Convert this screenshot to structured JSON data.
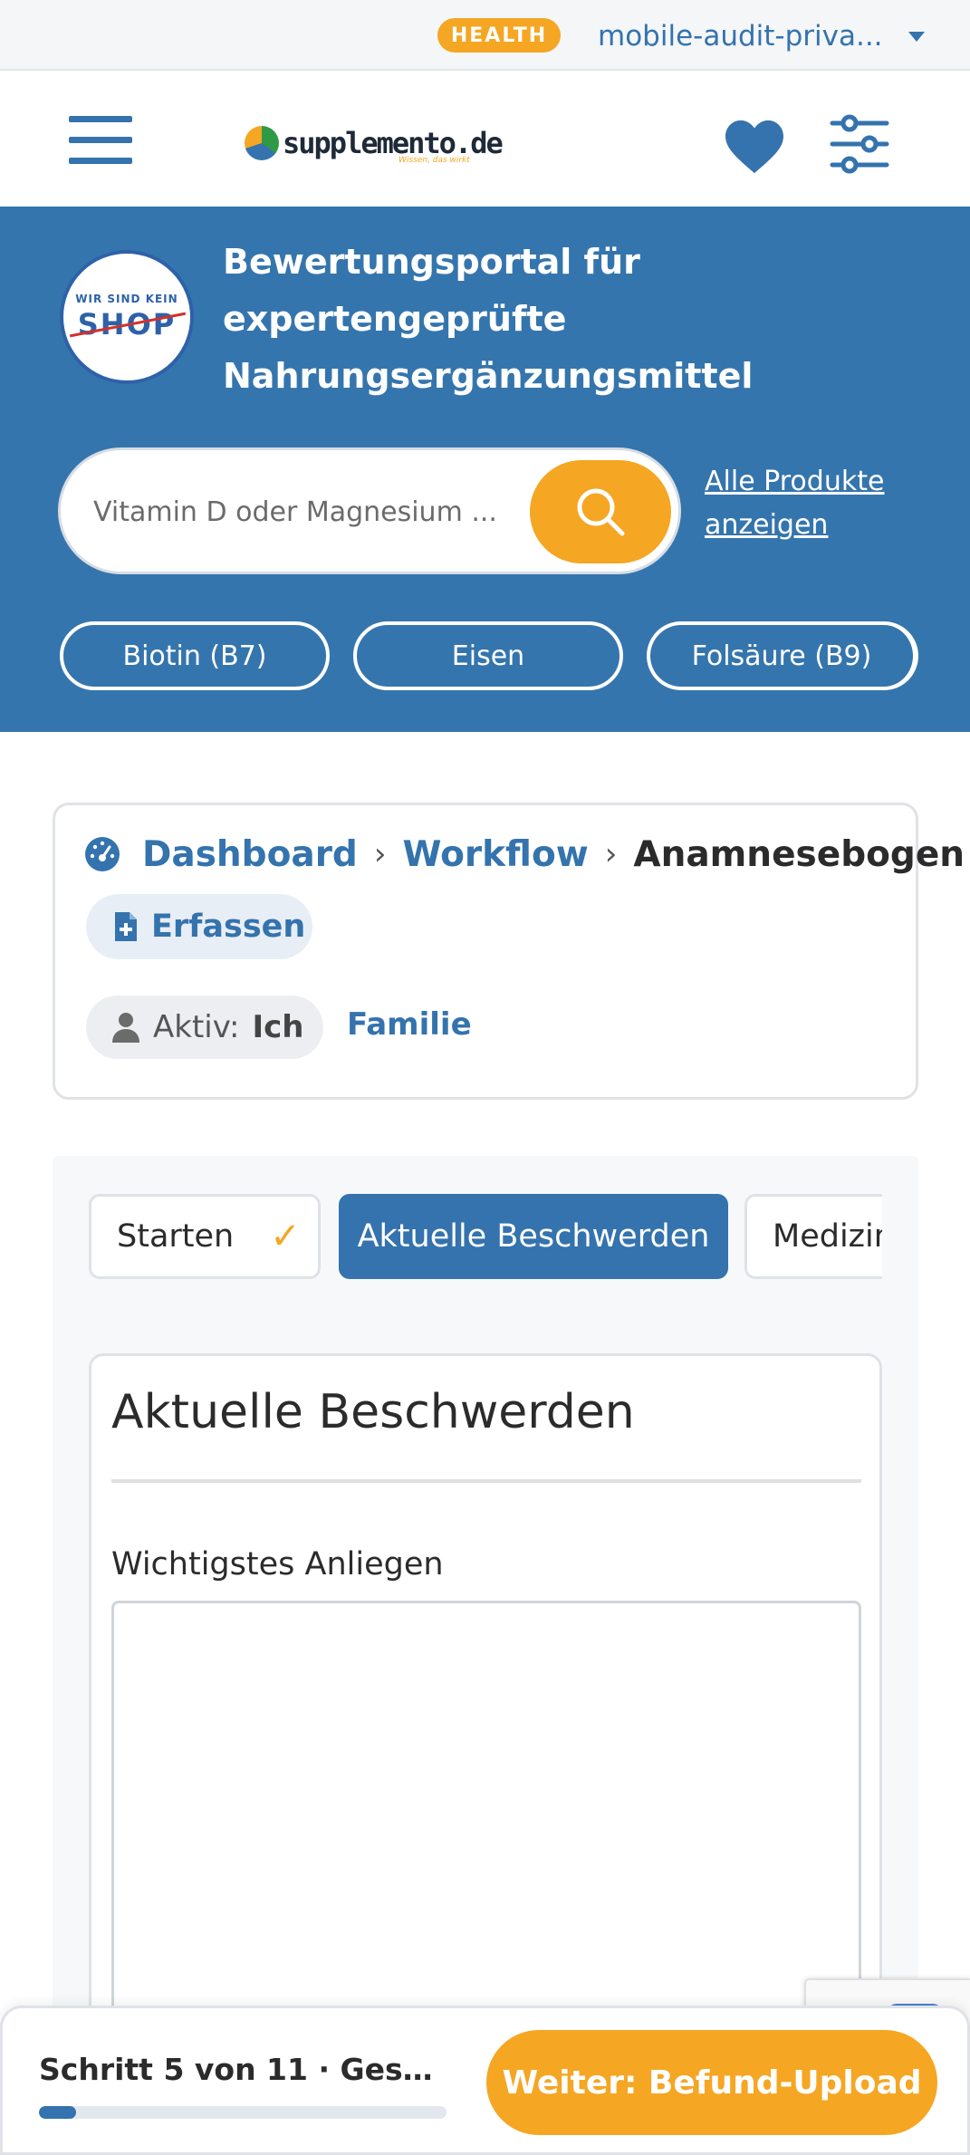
{
  "topbar": {
    "badge": "HEALTH",
    "account": "mobile-audit-priva..."
  },
  "header": {
    "logo_text": "supplemento.de",
    "logo_tagline": "Wissen, das wirkt"
  },
  "hero": {
    "badge_small": "WIR SIND KEIN",
    "badge_big": "SHOP",
    "title": "Bewertungsportal für expertengeprüfte Nahrungsergänzungsmittel",
    "search_placeholder": "Vitamin D oder Magnesium ...",
    "all_products_link": "Alle Produkte anzeigen",
    "chips": [
      "Biotin (B7)",
      "Eisen",
      "Folsäure (B9)"
    ]
  },
  "breadcrumb": {
    "items": [
      "Dashboard",
      "Workflow",
      "Anamnesebogen"
    ],
    "action": "Erfassen",
    "active_label": "Aktiv:",
    "active_value": "Ich",
    "alt_profile": "Familie"
  },
  "workflow": {
    "tabs": [
      {
        "label": "Starten",
        "state": "done"
      },
      {
        "label": "Aktuelle Beschwerden",
        "state": "active"
      },
      {
        "label": "Medizin",
        "state": "pending"
      }
    ],
    "section_title": "Aktuelle Beschwerden",
    "field_label": "Wichtigstes Anliegen",
    "field_value": ""
  },
  "bottom": {
    "step_text": "Schritt 5 von 11 · Gesun...",
    "progress_fraction": 0.09,
    "next_label": "Weiter: Befund-Upload"
  },
  "colors": {
    "brand_blue": "#3473ad",
    "accent_orange": "#f5a623"
  }
}
